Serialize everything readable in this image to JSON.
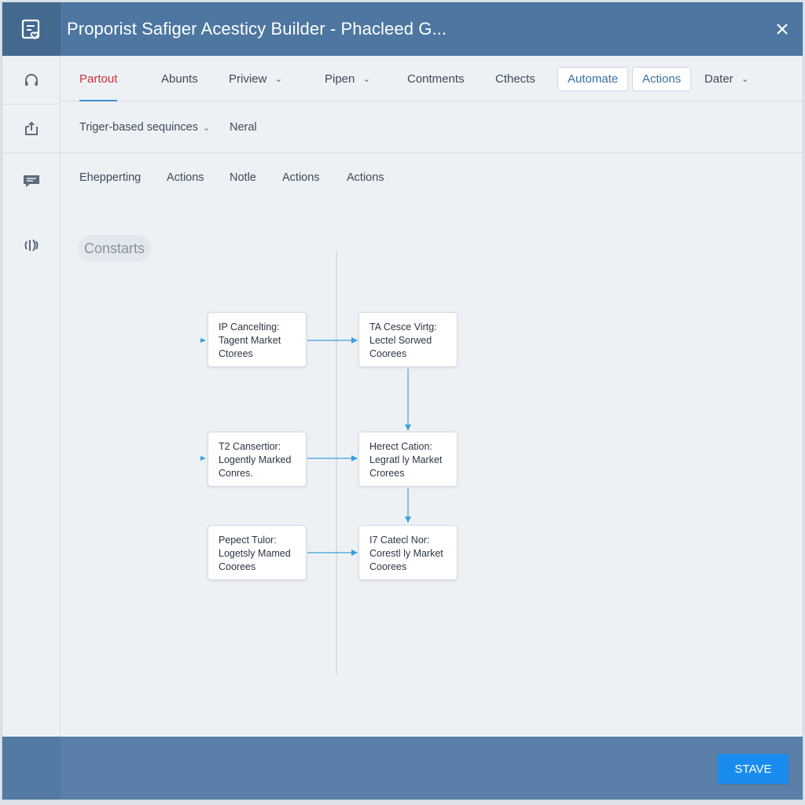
{
  "window": {
    "title": "Proporist Safiger Acesticy Builder - Phacleed G..."
  },
  "tabs": [
    {
      "label": "Partout",
      "chevron": false
    },
    {
      "label": "Abunts",
      "chevron": false
    },
    {
      "label": "Priview",
      "chevron": true
    },
    {
      "label": "Pipen",
      "chevron": true
    },
    {
      "label": "Contments",
      "chevron": false
    },
    {
      "label": "Cthects",
      "chevron": false
    },
    {
      "label": "Automate",
      "chevron": false
    },
    {
      "label": "Actions",
      "chevron": false
    },
    {
      "label": "Dater",
      "chevron": true
    }
  ],
  "row2": {
    "trigger_label": "Triger-based sequinces",
    "neral_label": "Neral"
  },
  "row3": [
    "Ehepperting",
    "Actions",
    "Notle",
    "Actions",
    "Actions"
  ],
  "chip": {
    "label": "Constarts"
  },
  "nodes": [
    {
      "lines": [
        "IP Cancelting:",
        "Tagent Market",
        "Ctorees"
      ]
    },
    {
      "lines": [
        "TA Cesce Virtg:",
        "Lectel Sorwed",
        "Coorees"
      ]
    },
    {
      "lines": [
        "T2 Cansertior:",
        "Logently Marked",
        "Conres."
      ]
    },
    {
      "lines": [
        "Herect Cation:",
        "Legratl ly Market",
        "Crorees"
      ]
    },
    {
      "lines": [
        "Pepect Tulor:",
        "Logetsly Mamed",
        "Coorees"
      ]
    },
    {
      "lines": [
        "I7 Catecl Nor:",
        "Corestl ly Market",
        "Coorees"
      ]
    }
  ],
  "footer": {
    "save_label": "STAVE"
  },
  "colors": {
    "titlebar": "#4d76a1",
    "active_tab": "#c8333a",
    "accent": "#3a8fd6",
    "connector": "#3aa0dc",
    "save_button": "#1a8cf0",
    "footer": "#5a80a9"
  },
  "icons": {
    "app": "clipboard-heart-icon",
    "close": "close-icon",
    "sidebar": [
      "headset-icon",
      "export-icon",
      "chat-icon",
      "signal-icon"
    ],
    "chevron": "chevron-down-icon"
  }
}
